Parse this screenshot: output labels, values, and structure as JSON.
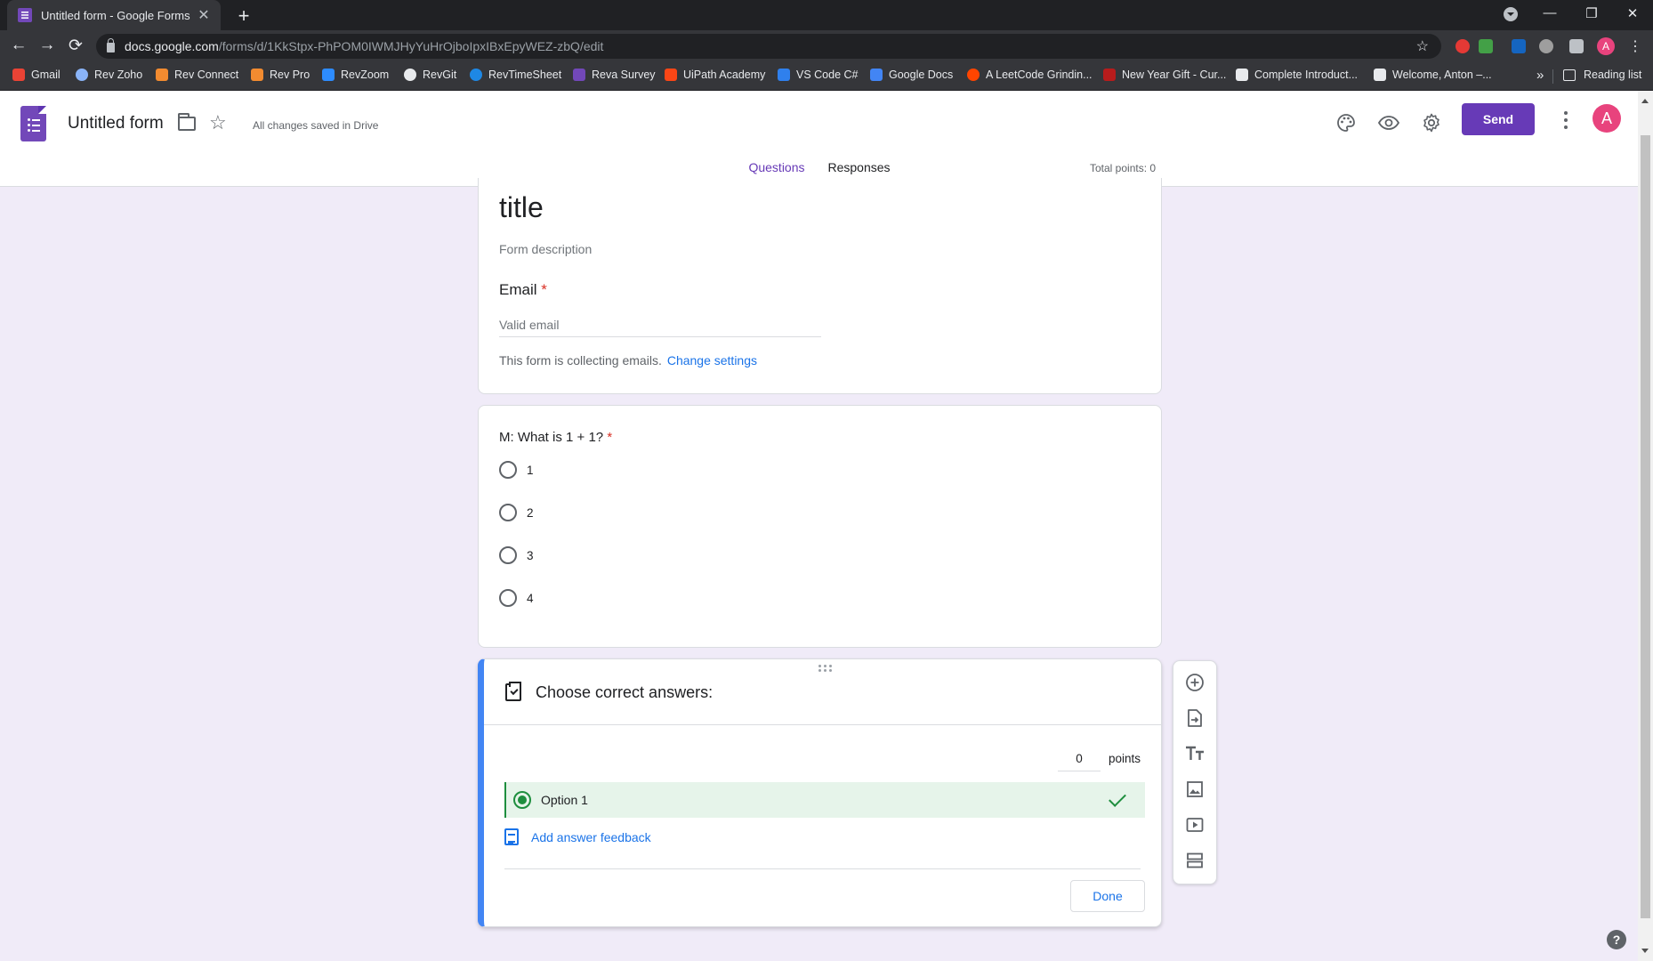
{
  "browser": {
    "tab_title": "Untitled form - Google Forms",
    "tab_close": "✕",
    "new_tab": "+",
    "window_controls": [
      "⌄",
      "—",
      "❐",
      "✕"
    ],
    "url_host": "docs.google.com",
    "url_path": "/forms/d/1KkStpx-PhPOM0IWMJHyYuHrOjboIpxIBxEpyWEZ-zbQ/edit",
    "profile_initial": "A",
    "bookmarks": [
      {
        "label": "Gmail",
        "color": "#ea4335"
      },
      {
        "label": "Rev Zoho",
        "color": "#8ab4f8"
      },
      {
        "label": "Rev Connect",
        "color": "#f28b30"
      },
      {
        "label": "Rev Pro",
        "color": "#f28b30"
      },
      {
        "label": "RevZoom",
        "color": "#2d8cff"
      },
      {
        "label": "RevGit",
        "color": "#e8eaed"
      },
      {
        "label": "RevTimeSheet",
        "color": "#1e88e5"
      },
      {
        "label": "Reva Survey",
        "color": "#7248b9"
      },
      {
        "label": "UiPath Academy",
        "color": "#fa4616"
      },
      {
        "label": "VS Code C#",
        "color": "#2f80ed"
      },
      {
        "label": "Google Docs",
        "color": "#4285f4"
      },
      {
        "label": "A LeetCode Grindin...",
        "color": "#ff4500"
      },
      {
        "label": "New Year Gift - Cur...",
        "color": "#b71c1c"
      },
      {
        "label": "Complete Introduct...",
        "color": "#e8eaed"
      },
      {
        "label": "Welcome, Anton –...",
        "color": "#e8eaed"
      }
    ],
    "bookmarks_more": "»",
    "reading_list": "Reading list"
  },
  "header": {
    "form_title": "Untitled form",
    "saved_status": "All changes saved in Drive",
    "send_label": "Send",
    "avatar_initial": "A",
    "tabs": [
      {
        "label": "Questions",
        "active": true
      },
      {
        "label": "Responses",
        "active": false
      }
    ],
    "total_points": "Total points: 0",
    "accent_color": "#673ab7"
  },
  "title_card": {
    "title": "title",
    "description_placeholder": "Form description",
    "email_label": "Email",
    "required_mark": "*",
    "email_placeholder": "Valid email",
    "collect_note": "This form is collecting emails.",
    "change_settings": "Change settings"
  },
  "question_card": {
    "question": "M: What is 1 + 1?",
    "required_mark": "*",
    "options": [
      "1",
      "2",
      "3",
      "4"
    ]
  },
  "answer_key_card": {
    "heading": "Choose correct answers:",
    "points_value": "0",
    "points_label": "points",
    "correct_option": "Option 1",
    "feedback_label": "Add answer feedback",
    "done_label": "Done",
    "correct_color": "#1e8e3e"
  },
  "side_toolbar": {
    "icons": [
      "add-question-icon",
      "import-questions-icon",
      "add-title-icon",
      "add-image-icon",
      "add-video-icon",
      "add-section-icon"
    ]
  },
  "help_label": "?"
}
